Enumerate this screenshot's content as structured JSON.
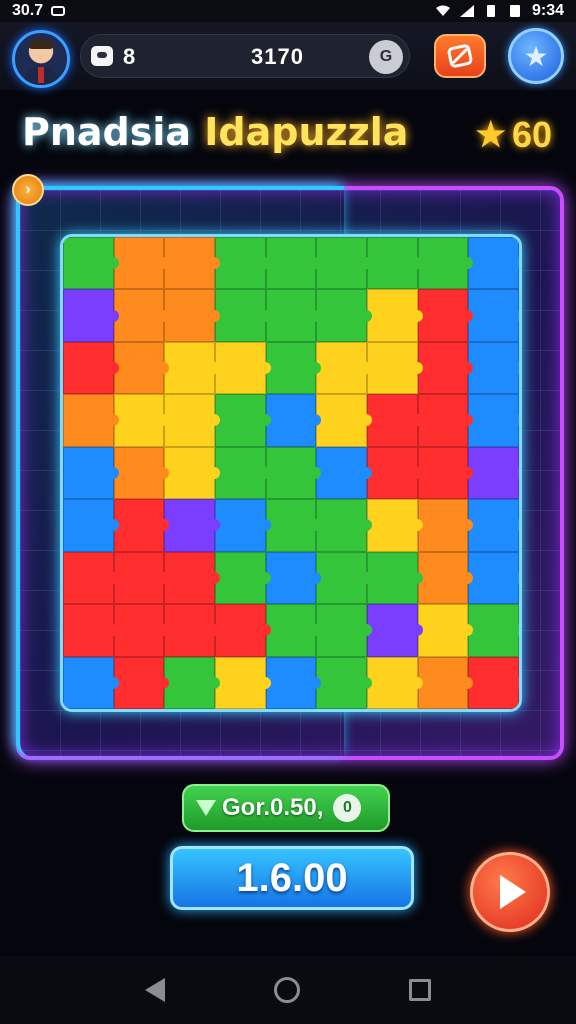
{
  "status": {
    "left_text": "30.7",
    "time": "9:34"
  },
  "header": {
    "counter": "8",
    "value": "3170",
    "right_icon": "G"
  },
  "title": {
    "part1": "Pnadsia ",
    "part2": "Idapuzzla",
    "stars": "60"
  },
  "board": {
    "palette": [
      "#ff2d2d",
      "#ff8a1e",
      "#ffd21e",
      "#34c53b",
      "#1e8bff",
      "#7b3dff",
      "#20c8d8"
    ]
  },
  "reward": {
    "label": "Gor.0.50,",
    "coin_icon": "0"
  },
  "score": {
    "value": "1.6.00"
  },
  "colors": {
    "accent_purple": "#c74dff",
    "accent_cyan": "#31c7ff",
    "green_button": "#2fb83a",
    "blue_button": "#1f8df0",
    "play_button": "#e8361f"
  }
}
